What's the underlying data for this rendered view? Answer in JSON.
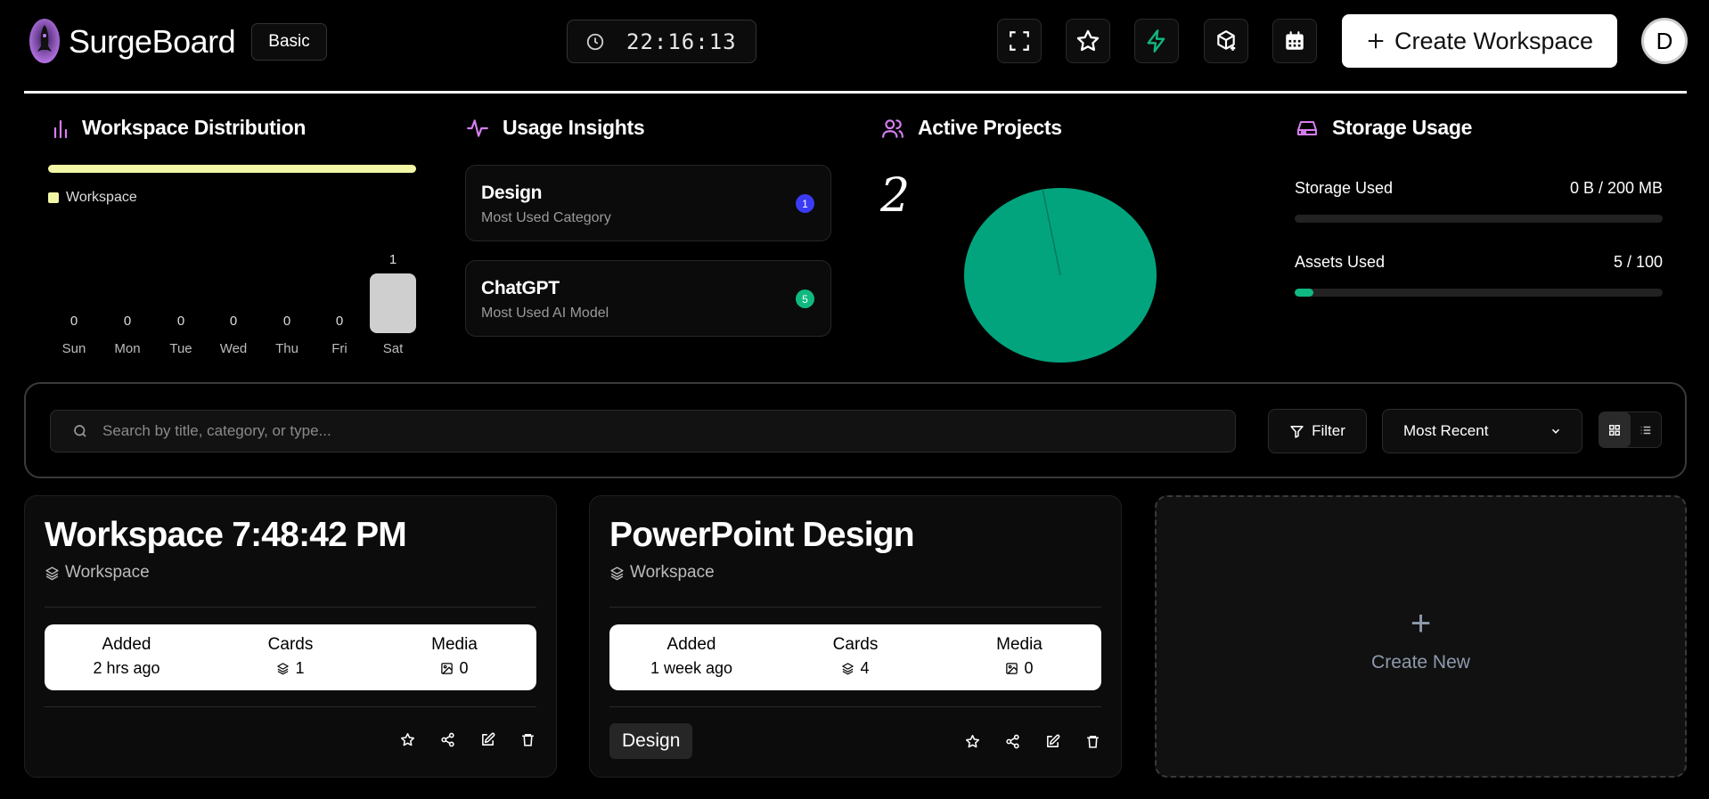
{
  "header": {
    "brand": "SurgeBoard",
    "plan": "Basic",
    "clock": "22:16:13",
    "icons": [
      "fullscreen-icon",
      "star-icon",
      "bolt-icon",
      "box-plus-icon",
      "calendar-icon"
    ],
    "create_label": "Create Workspace",
    "avatar_initial": "D"
  },
  "distribution": {
    "title": "Workspace Distribution",
    "legend": "Workspace",
    "legend_color": "#f2f7a6",
    "days": [
      {
        "label": "Sun",
        "value": "0"
      },
      {
        "label": "Mon",
        "value": "0"
      },
      {
        "label": "Tue",
        "value": "0"
      },
      {
        "label": "Wed",
        "value": "0"
      },
      {
        "label": "Thu",
        "value": "0"
      },
      {
        "label": "Fri",
        "value": "0"
      },
      {
        "label": "Sat",
        "value": "1"
      }
    ]
  },
  "insights": {
    "title": "Usage Insights",
    "items": [
      {
        "title": "Design",
        "subtitle": "Most Used Category",
        "badge": "1",
        "badge_color": "#3b3bf5"
      },
      {
        "title": "ChatGPT",
        "subtitle": "Most Used AI Model",
        "badge": "5",
        "badge_color": "#10b981"
      }
    ]
  },
  "projects": {
    "title": "Active Projects",
    "count": "2",
    "pie_color": "#02a47e"
  },
  "storage": {
    "title": "Storage Usage",
    "rows": [
      {
        "label": "Storage Used",
        "value": "0 B / 200 MB",
        "fraction": 0
      },
      {
        "label": "Assets Used",
        "value": "5 / 100",
        "fraction": 0.05
      }
    ]
  },
  "toolbar": {
    "search_placeholder": "Search by title, category, or type...",
    "filter_label": "Filter",
    "sort_value": "Most Recent"
  },
  "workspaces": [
    {
      "title": "Workspace 7:48:42 PM",
      "type": "Workspace",
      "added_label": "Added",
      "added": "2 hrs ago",
      "cards_label": "Cards",
      "cards": "1",
      "media_label": "Media",
      "media": "0",
      "tag": ""
    },
    {
      "title": "PowerPoint Design",
      "type": "Workspace",
      "added_label": "Added",
      "added": "1 week ago",
      "cards_label": "Cards",
      "cards": "4",
      "media_label": "Media",
      "media": "0",
      "tag": "Design"
    }
  ],
  "create_new_label": "Create New"
}
